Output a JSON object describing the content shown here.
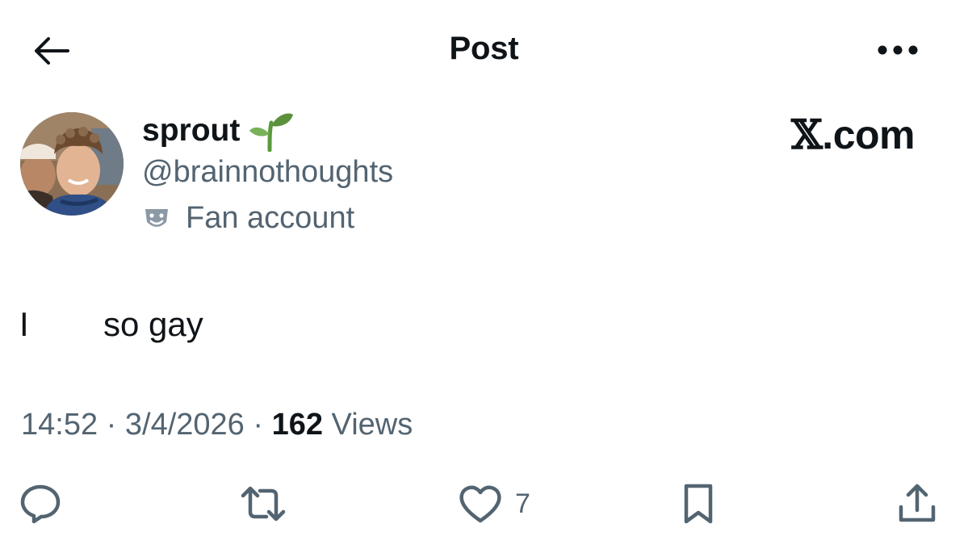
{
  "header": {
    "title": "Post",
    "back_icon": "arrow-left-icon",
    "more_icon": "more-horizontal-icon"
  },
  "author": {
    "display_name": "sprout",
    "name_emoji": "seedling-icon",
    "handle": "@brainnothoughts",
    "label": "Fan account",
    "label_icon": "theater-masks-icon"
  },
  "watermark": {
    "mark": "𝕏",
    "suffix": ".com"
  },
  "post": {
    "word_1": "I",
    "word_2": "so gay"
  },
  "meta": {
    "time": "14:52",
    "sep_1": " · ",
    "date": "3/4/2026",
    "sep_2": " · ",
    "views_count": "162",
    "views_label": " Views"
  },
  "actions": {
    "reply_icon": "reply-icon",
    "repost_icon": "repost-icon",
    "like_icon": "heart-icon",
    "like_count": "7",
    "bookmark_icon": "bookmark-icon",
    "share_icon": "share-icon"
  },
  "colors": {
    "text_primary": "#0f1419",
    "text_secondary": "#536471",
    "background": "#ffffff",
    "seedling_green": "#6aa84f"
  }
}
